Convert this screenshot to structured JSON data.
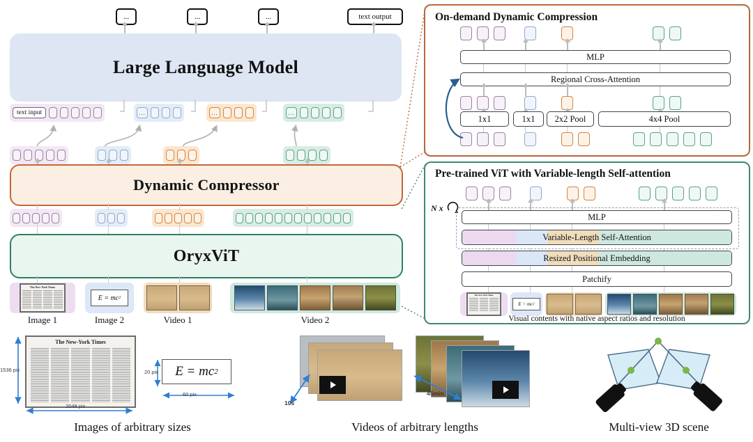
{
  "main": {
    "llm_label": "Large Language Model",
    "compressor_label": "Dynamic Compressor",
    "vit_label": "OryxViT",
    "text_input_chip": "text input",
    "text_output_chip": "text output",
    "ellipsis": "...",
    "outputs": [
      "...",
      "...",
      "...",
      "text output"
    ],
    "modalities": [
      {
        "name": "Image 1",
        "color": "#9b7fa6",
        "llm_tokens": 5,
        "compressed_tokens": 5,
        "vit_tokens": 5
      },
      {
        "name": "Image 2",
        "color": "#8fa9cd",
        "llm_tokens": 3,
        "compressed_tokens": 3,
        "vit_tokens": 3
      },
      {
        "name": "Video 1",
        "color": "#d3853f",
        "llm_tokens": 3,
        "compressed_tokens": 3,
        "vit_tokens": 5
      },
      {
        "name": "Video 2",
        "color": "#58a287",
        "llm_tokens": 4,
        "compressed_tokens": 5,
        "vit_tokens": 12
      }
    ]
  },
  "panel_odc": {
    "title": "On-demand Dynamic Compression",
    "mlp_label": "MLP",
    "cross_attention_label": "Regional Cross-Attention",
    "pool_ops": [
      "1x1",
      "1x1",
      "2x2 Pool",
      "4x4 Pool"
    ],
    "top_tokens": {
      "purple": 3,
      "blue": 1,
      "orange": 1,
      "green": 2
    },
    "mid_tokens": {
      "purple": 3,
      "blue": 1,
      "orange": 1,
      "green": 2
    },
    "bottom_tokens": {
      "purple": 3,
      "blue": 1,
      "orange": 2,
      "green": 5
    }
  },
  "panel_vit": {
    "title": "Pre-trained ViT with Variable-length Self-attention",
    "loop_label": "N x",
    "mlp_label": "MLP",
    "self_attention_label": "Variable-Length Self-Attention",
    "pos_embedding_label": "Resized Positional Embedding",
    "patchify_label": "Patchify",
    "caption": "Visual contents with native aspect ratios and resolution",
    "top_tokens": {
      "purple": 3,
      "blue": 1,
      "orange": 2,
      "green": 5
    }
  },
  "bottom": {
    "captions": [
      "Images of arbitrary sizes",
      "Videos of arbitrary lengths",
      "Multi-view 3D scene"
    ],
    "newspaper_title": "The New-York Times",
    "newspaper_height": "1536 pix",
    "newspaper_width": "2048 pix",
    "equation": "E = mc",
    "equation_exp": "2",
    "equation_height": "20 pix",
    "equation_width": "60 pix",
    "video1_duration": "10s",
    "video2_duration": "45min"
  },
  "colors": {
    "llm_bg": "#dee6f3",
    "compressor_bg": "#fbeee2",
    "compressor_border": "#c2683a",
    "vit_bg": "#e9f5ef",
    "vit_border": "#2e8062",
    "purple": "#9b7fa6",
    "blue": "#8fa9cd",
    "orange": "#d3853f",
    "green": "#58a287",
    "dim_blue": "#2f7fd0"
  }
}
